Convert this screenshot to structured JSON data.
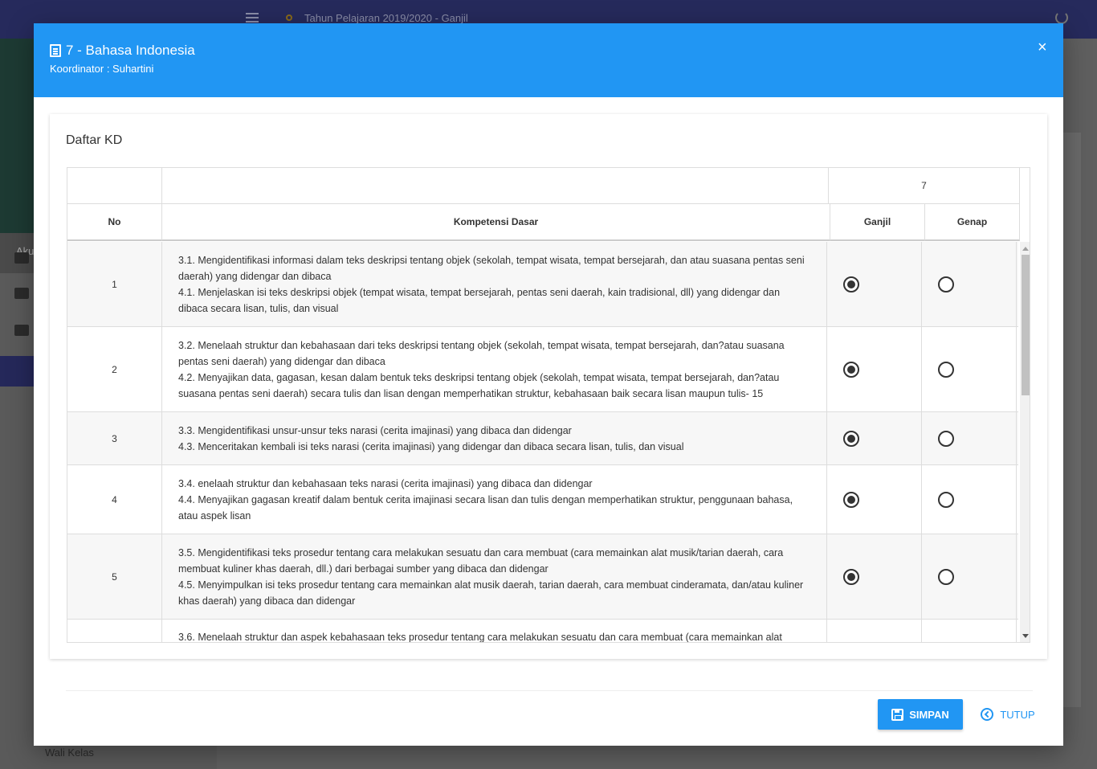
{
  "background": {
    "year_label": "Tahun Pelajaran 2019/2020 - Ganjil",
    "sidebar_account_label": "Aku",
    "sidebar_wali_label": "Wali Kelas",
    "topbar_color": "#262a5c"
  },
  "modal": {
    "title": "7 - Bahasa Indonesia",
    "subtitle": "Koordinator : Suhartini",
    "close_label": "×",
    "header_color": "#2196f3",
    "card_title": "Daftar KD",
    "table": {
      "group_header": "7",
      "columns": [
        "No",
        "Kompetensi Dasar",
        "Ganjil",
        "Genap"
      ],
      "rows": [
        {
          "no": "1",
          "kd": [
            "3.1. Mengidentifikasi informasi dalam teks deskripsi tentang objek (sekolah, tempat wisata, tempat bersejarah, dan atau suasana pentas seni daerah) yang didengar dan dibaca",
            "4.1. Menjelaskan isi teks deskripsi objek (tempat wisata, tempat bersejarah, pentas seni daerah, kain tradisional, dll) yang didengar dan dibaca secara lisan, tulis, dan visual"
          ],
          "selected": "ganjil"
        },
        {
          "no": "2",
          "kd": [
            "3.2. Menelaah struktur dan kebahasaan dari teks deskripsi tentang objek (sekolah, tempat wisata, tempat bersejarah, dan?atau suasana pentas seni daerah) yang didengar dan dibaca",
            "4.2. Menyajikan data, gagasan, kesan dalam bentuk teks deskripsi tentang objek (sekolah, tempat wisata, tempat bersejarah, dan?atau suasana pentas seni daerah) secara tulis dan lisan dengan memperhatikan struktur, kebahasaan baik secara lisan maupun tulis- 15"
          ],
          "selected": "ganjil"
        },
        {
          "no": "3",
          "kd": [
            "3.3. Mengidentifikasi unsur-unsur teks narasi (cerita imajinasi) yang dibaca dan didengar",
            "4.3. Menceritakan kembali isi teks narasi (cerita imajinasi) yang didengar dan dibaca secara lisan, tulis, dan visual"
          ],
          "selected": "ganjil"
        },
        {
          "no": "4",
          "kd": [
            "3.4. enelaah struktur dan kebahasaan teks narasi (cerita imajinasi) yang dibaca dan didengar",
            "4.4. Menyajikan gagasan kreatif dalam bentuk cerita imajinasi secara lisan dan tulis dengan memperhatikan struktur, penggunaan bahasa, atau aspek lisan"
          ],
          "selected": "ganjil"
        },
        {
          "no": "5",
          "kd": [
            "3.5. Mengidentifikasi teks prosedur tentang cara melakukan sesuatu dan cara membuat (cara memainkan alat musik/tarian daerah, cara membuat kuliner khas daerah, dll.) dari berbagai sumber yang dibaca dan didengar",
            "4.5. Menyimpulkan isi teks prosedur tentang cara memainkan alat musik daerah, tarian daerah, cara membuat cinderamata, dan/atau kuliner khas daerah) yang dibaca dan didengar"
          ],
          "selected": "ganjil"
        },
        {
          "no": "",
          "kd": [
            "3.6. Menelaah struktur dan aspek kebahasaan teks prosedur tentang cara melakukan sesuatu dan cara membuat (cara memainkan alat"
          ],
          "selected": ""
        }
      ]
    },
    "buttons": {
      "save_label": "SIMPAN",
      "close_label": "TUTUP"
    }
  }
}
